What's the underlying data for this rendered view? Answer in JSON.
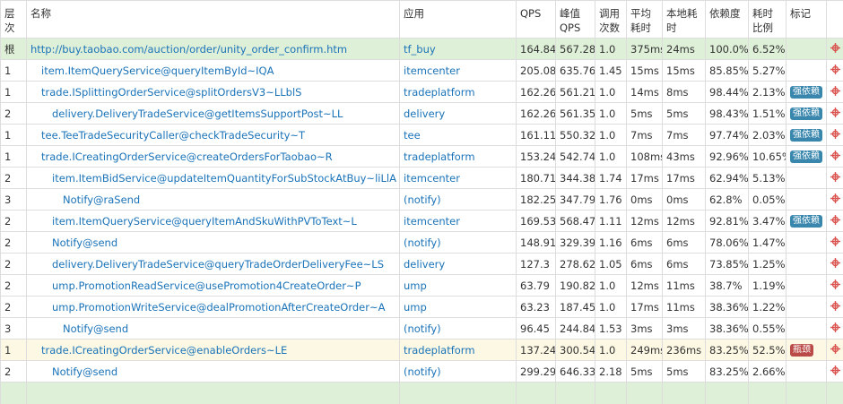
{
  "columns": [
    "层次",
    "名称",
    "应用",
    "QPS",
    "峰值QPS",
    "调用次数",
    "平均耗时",
    "本地耗时",
    "依赖度",
    "耗时比例",
    "标记"
  ],
  "rows": [
    {
      "level": "根",
      "indent": 0,
      "name": "http://buy.taobao.com/auction/order/unity_order_confirm.htm",
      "app": "tf_buy",
      "qps": "164.84",
      "peak": "567.28",
      "calls": "1.0",
      "avg": "375ms",
      "local": "24ms",
      "dep": "100.0%",
      "ratio": "6.52%",
      "tag": "",
      "style": "root"
    },
    {
      "level": "1",
      "indent": 1,
      "name": "item.ItemQueryService@queryItemById~IQA",
      "app": "itemcenter",
      "qps": "205.08",
      "peak": "635.76",
      "calls": "1.45",
      "avg": "15ms",
      "local": "15ms",
      "dep": "85.85%",
      "ratio": "5.27%",
      "tag": ""
    },
    {
      "level": "1",
      "indent": 1,
      "name": "trade.ISplittingOrderService@splitOrdersV3~LLblS",
      "app": "tradeplatform",
      "qps": "162.26",
      "peak": "561.21",
      "calls": "1.0",
      "avg": "14ms",
      "local": "8ms",
      "dep": "98.44%",
      "ratio": "2.13%",
      "tag": "强依赖",
      "tagType": "info"
    },
    {
      "level": "2",
      "indent": 2,
      "name": "delivery.DeliveryTradeService@getItemsSupportPost~LL",
      "app": "delivery",
      "qps": "162.26",
      "peak": "561.35",
      "calls": "1.0",
      "avg": "5ms",
      "local": "5ms",
      "dep": "98.43%",
      "ratio": "1.51%",
      "tag": "强依赖",
      "tagType": "info"
    },
    {
      "level": "1",
      "indent": 1,
      "name": "tee.TeeTradeSecurityCaller@checkTradeSecurity~T",
      "app": "tee",
      "qps": "161.11",
      "peak": "550.32",
      "calls": "1.0",
      "avg": "7ms",
      "local": "7ms",
      "dep": "97.74%",
      "ratio": "2.03%",
      "tag": "强依赖",
      "tagType": "info"
    },
    {
      "level": "1",
      "indent": 1,
      "name": "trade.ICreatingOrderService@createOrdersForTaobao~R",
      "app": "tradeplatform",
      "qps": "153.24",
      "peak": "542.74",
      "calls": "1.0",
      "avg": "108ms",
      "local": "43ms",
      "dep": "92.96%",
      "ratio": "10.65%",
      "tag": "强依赖",
      "tagType": "info"
    },
    {
      "level": "2",
      "indent": 2,
      "name": "item.ItemBidService@updateItemQuantityForSubStockAtBuy~liLlA",
      "app": "itemcenter",
      "qps": "180.71",
      "peak": "344.38",
      "calls": "1.74",
      "avg": "17ms",
      "local": "17ms",
      "dep": "62.94%",
      "ratio": "5.13%",
      "tag": ""
    },
    {
      "level": "3",
      "indent": 3,
      "name": "Notify@raSend",
      "app": "(notify)",
      "qps": "182.25",
      "peak": "347.79",
      "calls": "1.76",
      "avg": "0ms",
      "local": "0ms",
      "dep": "62.8%",
      "ratio": "0.05%",
      "tag": ""
    },
    {
      "level": "2",
      "indent": 2,
      "name": "item.ItemQueryService@queryItemAndSkuWithPVToText~L",
      "app": "itemcenter",
      "qps": "169.53",
      "peak": "568.47",
      "calls": "1.11",
      "avg": "12ms",
      "local": "12ms",
      "dep": "92.81%",
      "ratio": "3.47%",
      "tag": "强依赖",
      "tagType": "info"
    },
    {
      "level": "2",
      "indent": 2,
      "name": "Notify@send",
      "app": "(notify)",
      "qps": "148.91",
      "peak": "329.39",
      "calls": "1.16",
      "avg": "6ms",
      "local": "6ms",
      "dep": "78.06%",
      "ratio": "1.47%",
      "tag": ""
    },
    {
      "level": "2",
      "indent": 2,
      "name": "delivery.DeliveryTradeService@queryTradeOrderDeliveryFee~LS",
      "app": "delivery",
      "qps": "127.3",
      "peak": "278.62",
      "calls": "1.05",
      "avg": "6ms",
      "local": "6ms",
      "dep": "73.85%",
      "ratio": "1.25%",
      "tag": ""
    },
    {
      "level": "2",
      "indent": 2,
      "name": "ump.PromotionReadService@usePromotion4CreateOrder~P",
      "app": "ump",
      "qps": "63.79",
      "peak": "190.82",
      "calls": "1.0",
      "avg": "12ms",
      "local": "11ms",
      "dep": "38.7%",
      "ratio": "1.19%",
      "tag": ""
    },
    {
      "level": "2",
      "indent": 2,
      "name": "ump.PromotionWriteService@dealPromotionAfterCreateOrder~A",
      "app": "ump",
      "qps": "63.23",
      "peak": "187.45",
      "calls": "1.0",
      "avg": "17ms",
      "local": "11ms",
      "dep": "38.36%",
      "ratio": "1.22%",
      "tag": ""
    },
    {
      "level": "3",
      "indent": 3,
      "name": "Notify@send",
      "app": "(notify)",
      "qps": "96.45",
      "peak": "244.84",
      "calls": "1.53",
      "avg": "3ms",
      "local": "3ms",
      "dep": "38.36%",
      "ratio": "0.55%",
      "tag": ""
    },
    {
      "level": "1",
      "indent": 1,
      "name": "trade.ICreatingOrderService@enableOrders~LE",
      "app": "tradeplatform",
      "qps": "137.24",
      "peak": "300.54",
      "calls": "1.0",
      "avg": "249ms",
      "local": "236ms",
      "dep": "83.25%",
      "ratio": "52.5%",
      "tag": "瓶颈",
      "tagType": "danger",
      "style": "hl"
    },
    {
      "level": "2",
      "indent": 2,
      "name": "Notify@send",
      "app": "(notify)",
      "qps": "299.29",
      "peak": "646.33",
      "calls": "2.18",
      "avg": "5ms",
      "local": "5ms",
      "dep": "83.25%",
      "ratio": "2.66%",
      "tag": ""
    }
  ],
  "colors": {
    "root": "#dff0d8",
    "highlight": "#fcf8e3",
    "link": "#1a73b8",
    "badge_info": "#3a87ad",
    "badge_danger": "#b94a48",
    "action_icon": "#d9534f"
  },
  "action_icon": "crosshair-icon"
}
